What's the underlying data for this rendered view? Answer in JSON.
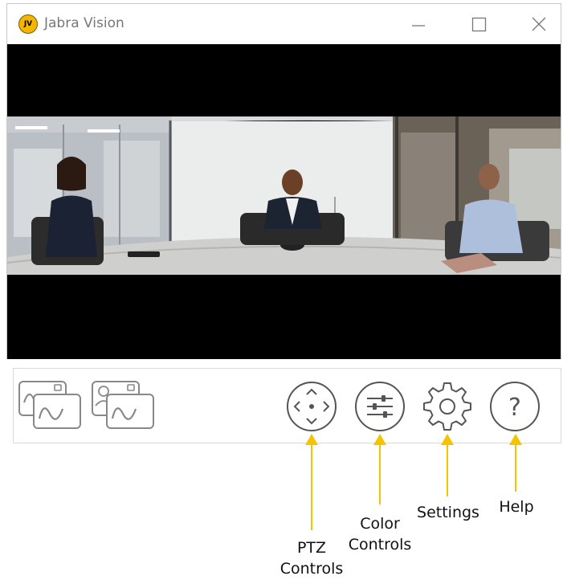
{
  "window": {
    "title": "Jabra Vision",
    "logo_text": "JV"
  },
  "toolbar": {
    "buttons": [
      {
        "name": "PTZ Controls",
        "icon": "ptz-icon"
      },
      {
        "name": "Color Controls",
        "icon": "color-controls-icon"
      },
      {
        "name": "Settings",
        "icon": "gear-icon"
      },
      {
        "name": "Help",
        "icon": "help-icon"
      }
    ],
    "help_glyph": "?"
  },
  "annotations": {
    "ptz_line1": "PTZ",
    "ptz_line2": "Controls",
    "color_line1": "Color",
    "color_line2": "Controls",
    "settings": "Settings",
    "help": "Help",
    "arrow_color": "#f5c400"
  }
}
